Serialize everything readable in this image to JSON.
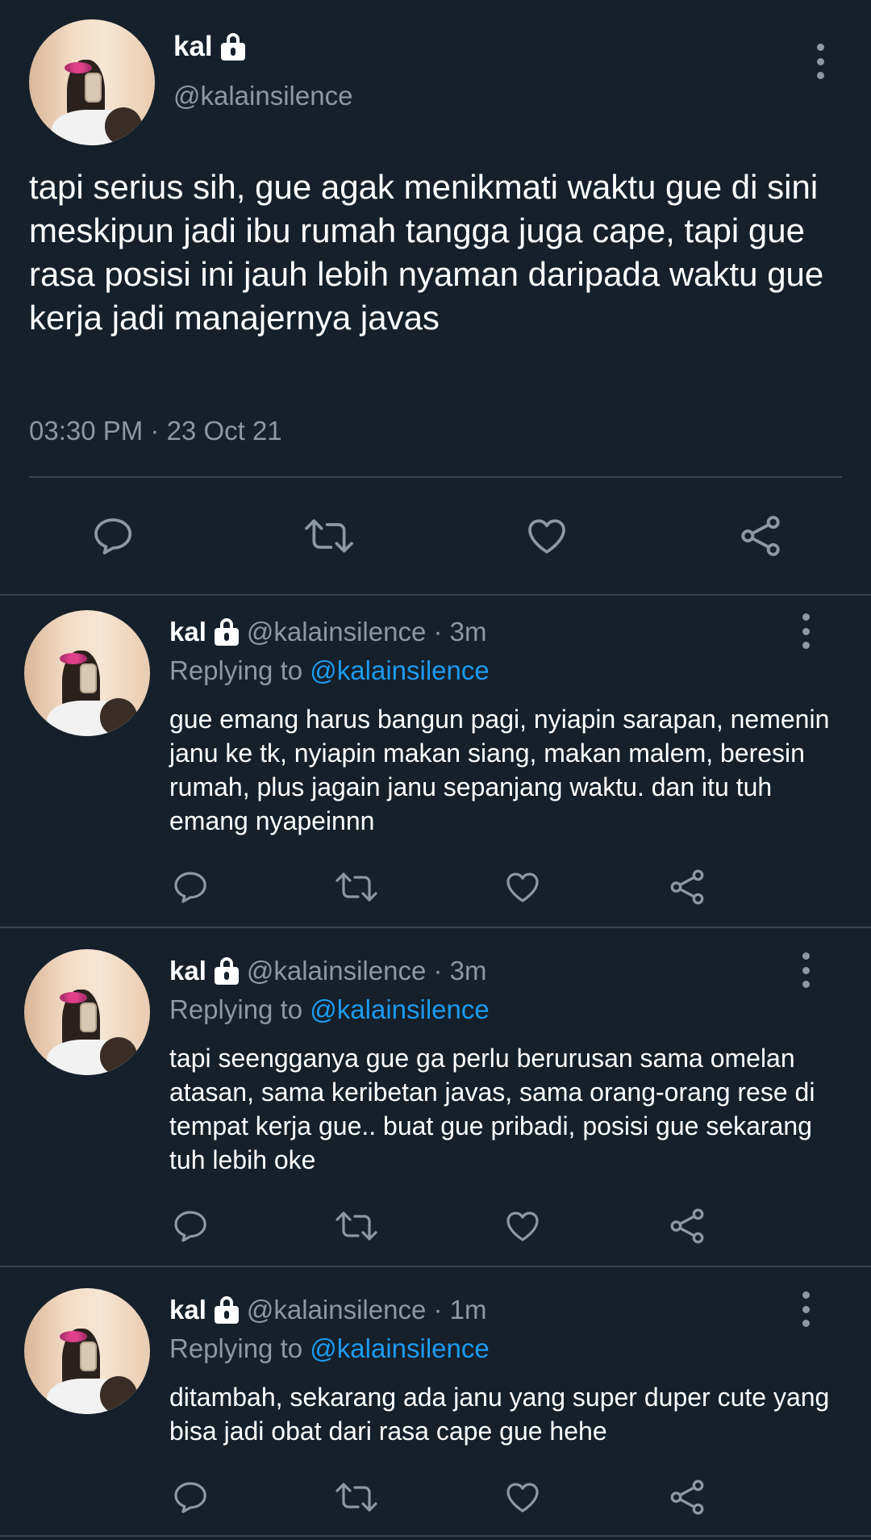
{
  "main_tweet": {
    "name": "kal",
    "handle": "@kalainsilence",
    "text": "tapi serius sih, gue agak menikmati waktu gue di sini\nmeskipun jadi ibu rumah tangga juga cape, tapi gue rasa posisi ini jauh lebih nyaman daripada waktu gue kerja jadi manajernya javas",
    "timestamp": "03:30 PM · 23 Oct 21"
  },
  "replies": [
    {
      "name": "kal",
      "meta": "@kalainsilence · 3m",
      "replying_prefix": "Replying to",
      "replying_to": "@kalainsilence",
      "text": "gue emang harus bangun pagi, nyiapin sarapan, nemenin janu ke tk, nyiapin makan siang, makan malem, beresin rumah, plus jagain janu sepanjang waktu. dan itu tuh emang nyapeinnn"
    },
    {
      "name": "kal",
      "meta": "@kalainsilence · 3m",
      "replying_prefix": "Replying to",
      "replying_to": "@kalainsilence",
      "text": "tapi seengganya gue ga perlu berurusan sama omelan atasan, sama keribetan javas, sama orang-orang rese di tempat kerja gue.. buat gue pribadi, posisi gue sekarang tuh lebih oke"
    },
    {
      "name": "kal",
      "meta": "@kalainsilence · 1m",
      "replying_prefix": "Replying to",
      "replying_to": "@kalainsilence",
      "text": "ditambah, sekarang ada janu yang super duper cute yang bisa jadi obat dari rasa cape gue hehe"
    }
  ],
  "colors": {
    "background": "#15202b",
    "text": "#ffffff",
    "secondary": "#8b98a5",
    "accent": "#1d9bf0",
    "divider": "#38444d"
  },
  "icons": [
    "reply-icon",
    "retweet-icon",
    "like-icon",
    "share-icon",
    "lock-icon",
    "more-icon"
  ]
}
